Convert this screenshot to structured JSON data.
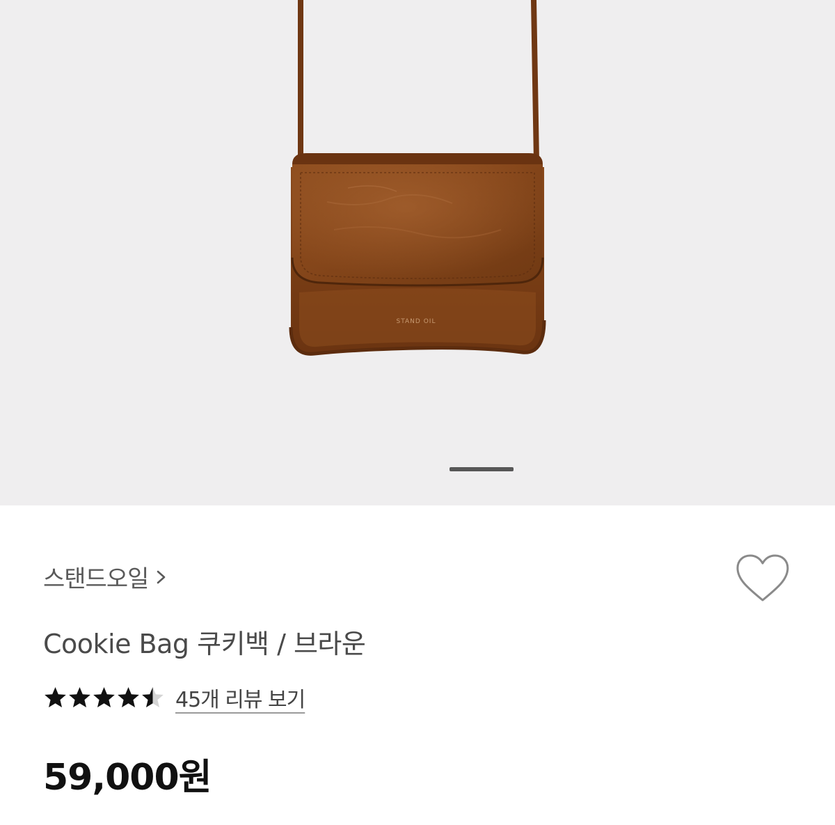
{
  "product": {
    "image": {
      "subject": "brown leather crossbody bag",
      "bag_logo_text": "STAND OIL",
      "background_color": "#efeeef",
      "bag_color": "#7a3f17"
    },
    "carousel": {
      "active_slide_index": 0,
      "indicator_color": "#575757"
    },
    "brand": {
      "label": "스탠드오일",
      "chevron_icon": "chevron-right-icon"
    },
    "wishlist": {
      "icon": "heart-outline-icon",
      "active": false
    },
    "name": "Cookie Bag 쿠키백 / 브라운",
    "rating": {
      "value": 4.5,
      "max": 5,
      "star_icon": "star-icon"
    },
    "reviews": {
      "link_label": "45개 리뷰 보기"
    },
    "price": "59,000원"
  }
}
